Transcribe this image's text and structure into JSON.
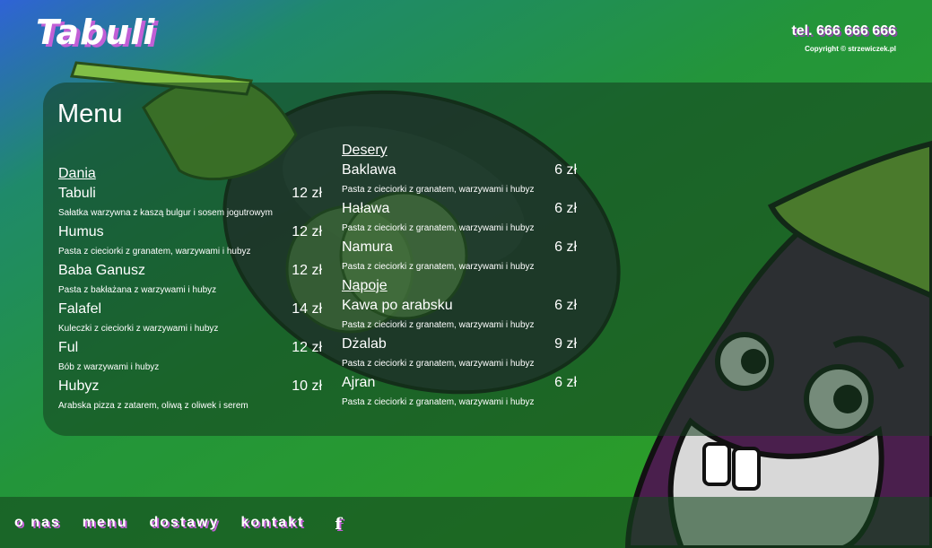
{
  "brand": {
    "logo": "Tabuli"
  },
  "header": {
    "phone": "tel. 666 666 666",
    "copyright": "Copyright © strzewiczek.pl"
  },
  "menu": {
    "title": "Menu",
    "dania": {
      "heading": "Dania",
      "items": [
        {
          "name": "Tabuli",
          "price": "12 zł",
          "desc": "Sałatka warzywna z kaszą bulgur i sosem jogutrowym"
        },
        {
          "name": "Humus",
          "price": "12 zł",
          "desc": "Pasta z cieciorki z granatem, warzywami i hubyz"
        },
        {
          "name": "Baba Ganusz",
          "price": "12 zł",
          "desc": "Pasta z bakłażana z warzywami i hubyz"
        },
        {
          "name": "Falafel",
          "price": "14 zł",
          "desc": "Kuleczki z cieciorki z warzywami i hubyz"
        },
        {
          "name": "Ful",
          "price": "12 zł",
          "desc": "Bób z warzywami i hubyz"
        },
        {
          "name": "Hubyz",
          "price": "10 zł",
          "desc": "Arabska pizza z zatarem, oliwą z oliwek i serem"
        }
      ]
    },
    "desery": {
      "heading": "Desery",
      "items": [
        {
          "name": "Baklawa",
          "price": "6 zł",
          "desc": "Pasta z cieciorki z granatem, warzywami i hubyz"
        },
        {
          "name": "Haława",
          "price": "6 zł",
          "desc": "Pasta z cieciorki z granatem, warzywami i hubyz"
        },
        {
          "name": "Namura",
          "price": "6 zł",
          "desc": "Pasta z cieciorki z granatem, warzywami i hubyz"
        }
      ]
    },
    "napoje": {
      "heading": "Napoje",
      "items": [
        {
          "name": "Kawa po arabsku",
          "price": "6 zł",
          "desc": "Pasta z cieciorki z granatem, warzywami i hubyz"
        },
        {
          "name": "Dżalab",
          "price": "9 zł",
          "desc": "Pasta z cieciorki z granatem, warzywami i hubyz"
        },
        {
          "name": "Ajran",
          "price": "6 zł",
          "desc": "Pasta z cieciorki z granatem, warzywami i hubyz"
        }
      ]
    }
  },
  "footer": {
    "nav": [
      "o nas",
      "menu",
      "dostawy",
      "kontakt"
    ],
    "social_icon": "facebook-icon",
    "social_glyph": "f"
  },
  "colors": {
    "accent_shadow": "#c25fd6",
    "eggplant": "#4a1f4d",
    "leaf": "#8cc63f"
  }
}
